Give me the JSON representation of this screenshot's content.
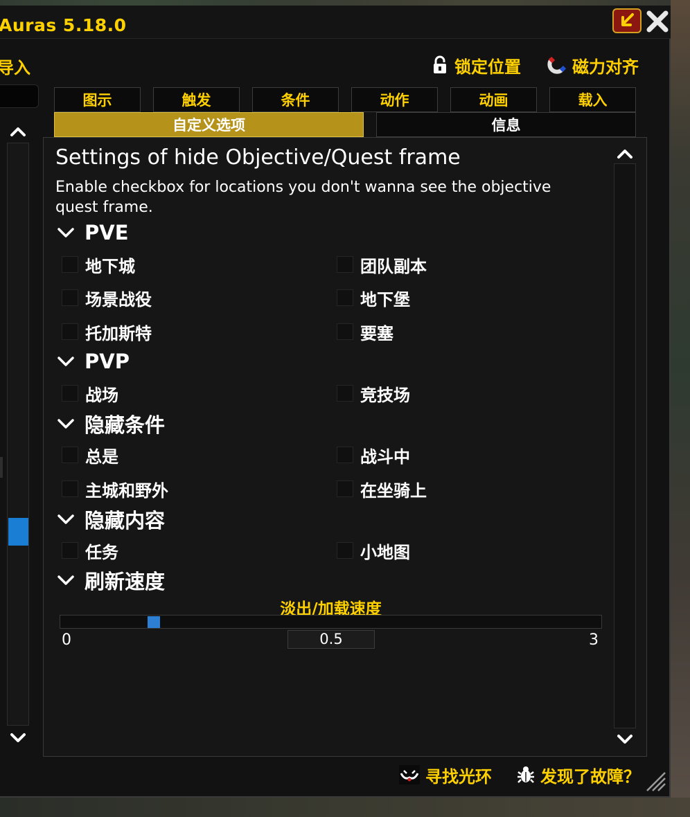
{
  "window": {
    "title": "Auras 5.18.0"
  },
  "toolbar": {
    "import_label": "导入",
    "lock_label": "锁定位置",
    "magnet_label": "磁力对齐"
  },
  "tabs": [
    {
      "label": "图示"
    },
    {
      "label": "触发"
    },
    {
      "label": "条件"
    },
    {
      "label": "动作"
    },
    {
      "label": "动画"
    },
    {
      "label": "载入"
    }
  ],
  "subtabs": [
    {
      "label": "自定义选项",
      "active": true
    },
    {
      "label": "信息",
      "active": false
    }
  ],
  "content": {
    "heading": "Settings of hide Objective/Quest frame",
    "description": "Enable checkbox for locations you don't wanna see the objective quest frame.",
    "sections": [
      {
        "title": "PVE",
        "options": [
          {
            "label": "地下城",
            "checked": false
          },
          {
            "label": "团队副本",
            "checked": false
          },
          {
            "label": "场景战役",
            "checked": false
          },
          {
            "label": "地下堡",
            "checked": false
          },
          {
            "label": "托加斯特",
            "checked": false
          },
          {
            "label": "要塞",
            "checked": false
          }
        ]
      },
      {
        "title": "PVP",
        "options": [
          {
            "label": "战场",
            "checked": false
          },
          {
            "label": "竞技场",
            "checked": false
          }
        ]
      },
      {
        "title": "隐藏条件",
        "options": [
          {
            "label": "总是",
            "checked": false
          },
          {
            "label": "战斗中",
            "checked": false
          },
          {
            "label": "主城和野外",
            "checked": false
          },
          {
            "label": "在坐骑上",
            "checked": false
          }
        ]
      },
      {
        "title": "隐藏内容",
        "options": [
          {
            "label": "任务",
            "checked": false
          },
          {
            "label": "小地图",
            "checked": false
          }
        ]
      },
      {
        "title": "刷新速度"
      }
    ],
    "slider": {
      "title": "淡出/加载速度",
      "min": "0",
      "max": "3",
      "value": "0.5"
    }
  },
  "footer": {
    "find_label": "寻找光环",
    "bug_label": "发现了故障？"
  },
  "colors": {
    "accent_gold": "#ffd100",
    "active_tab": "#b5931a",
    "scroll_thumb": "#1a7fd4"
  }
}
